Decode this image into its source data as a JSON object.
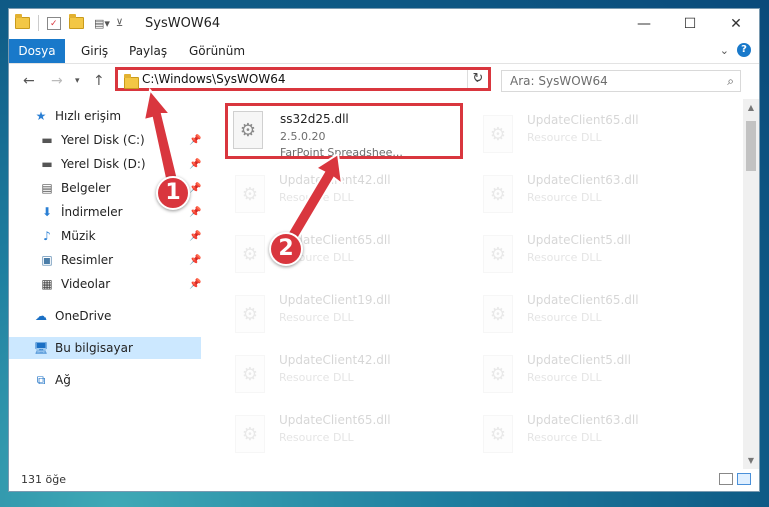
{
  "window": {
    "title": "SysWOW64"
  },
  "ribbon": {
    "tabs": [
      "Dosya",
      "Giriş",
      "Paylaş",
      "Görünüm"
    ],
    "help": "?"
  },
  "address": {
    "path": "C:\\Windows\\SysWOW64",
    "search_placeholder": "Ara: SysWOW64"
  },
  "sidebar": {
    "items": [
      {
        "label": "Hızlı erişim"
      },
      {
        "label": "Yerel Disk (C:)"
      },
      {
        "label": "Yerel Disk (D:)"
      },
      {
        "label": "Belgeler"
      },
      {
        "label": "İndirmeler"
      },
      {
        "label": "Müzik"
      },
      {
        "label": "Resimler"
      },
      {
        "label": "Videolar"
      },
      {
        "label": "OneDrive"
      },
      {
        "label": "Bu bilgisayar"
      },
      {
        "label": "Ağ"
      }
    ]
  },
  "files": {
    "highlight": {
      "name": "ss32d25.dll",
      "version": "2.5.0.20",
      "description": "FarPoint Spreadshee..."
    },
    "left_col": [
      {
        "name": "UpdateClient42.dll",
        "type": "Resource DLL"
      },
      {
        "name": "UpdateClient65.dll",
        "type": "Resource DLL"
      },
      {
        "name": "UpdateClient19.dll",
        "type": "Resource DLL"
      },
      {
        "name": "UpdateClient42.dll",
        "type": "Resource DLL"
      },
      {
        "name": "UpdateClient65.dll",
        "type": "Resource DLL"
      }
    ],
    "right_col": [
      {
        "name": "UpdateClient65.dll",
        "type": "Resource DLL"
      },
      {
        "name": "UpdateClient63.dll",
        "type": "Resource DLL"
      },
      {
        "name": "UpdateClient5.dll",
        "type": "Resource DLL"
      },
      {
        "name": "UpdateClient65.dll",
        "type": "Resource DLL"
      },
      {
        "name": "UpdateClient5.dll",
        "type": "Resource DLL"
      },
      {
        "name": "UpdateClient63.dll",
        "type": "Resource DLL"
      }
    ]
  },
  "status": {
    "count": "131 öğe"
  },
  "callouts": {
    "one": "1",
    "two": "2"
  },
  "colors": {
    "accent": "#1979ca",
    "callout": "#d9363e",
    "selected": "#cce8ff"
  }
}
